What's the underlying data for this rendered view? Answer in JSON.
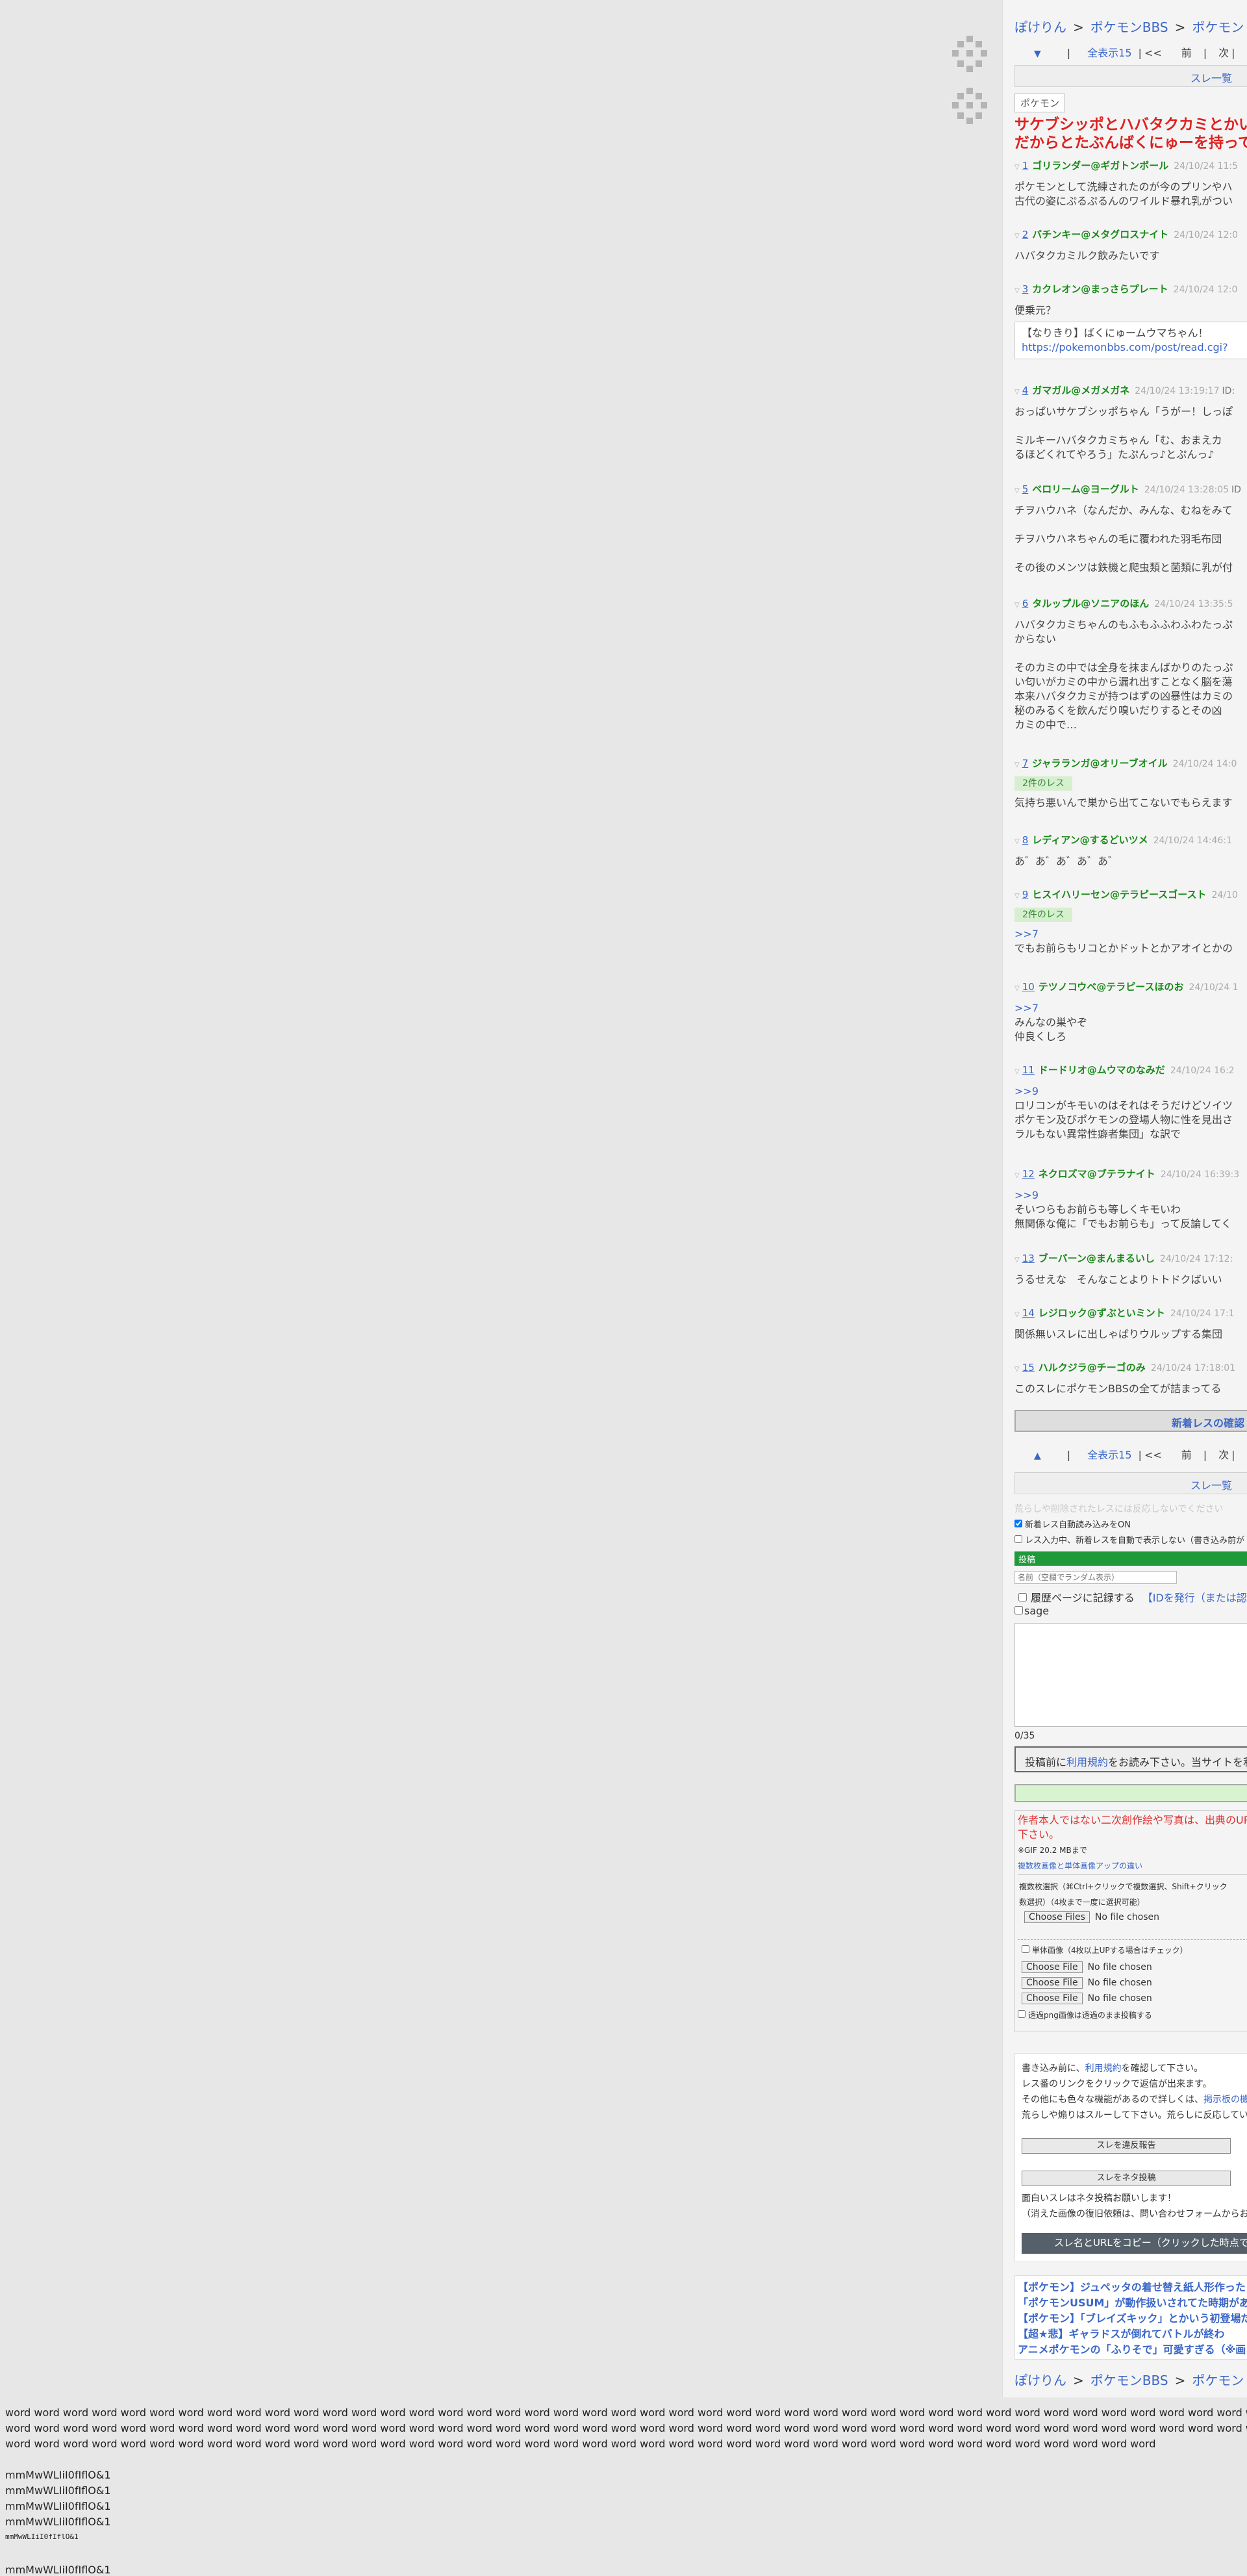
{
  "breadcrumb": [
    "ぽけりん",
    "ポケモンBBS",
    "ポケモン"
  ],
  "nav": {
    "down_arrow": "▼",
    "up_arrow": "▲",
    "show_all": "全表示15",
    "first": "<<",
    "prev": "前",
    "next": "次",
    "sep": "|"
  },
  "thread_list": "スレ一覧",
  "category_tag": "ポケモン",
  "title_lines": [
    "サケブシッポとハバタクカミとかい",
    "だからとたぶんばくにゅーを持って"
  ],
  "posts": [
    {
      "no": "1",
      "name": "ゴリランダー@ギガトンボール",
      "date": "24/10/24 11:5",
      "lines": [
        "ポケモンとして洗練されたのが今のプリンやハ",
        "古代の姿にぷるぷるんのワイルド暴れ乳がつい"
      ]
    },
    {
      "no": "2",
      "name": "バチンキー@メタグロスナイト",
      "date": "24/10/24 12:0",
      "lines": [
        "ハバタクカミルク飲みたいです"
      ]
    },
    {
      "no": "3",
      "name": "カクレオン@まっさらプレート",
      "date": "24/10/24 12:0",
      "lines": [
        "便乗元？"
      ],
      "quote": [
        "【なりきり】ばくにゅームウマちゃん！",
        "https://pokemonbbs.com/post/read.cgi?"
      ]
    },
    {
      "no": "4",
      "name": "ガマガル@メガメガネ",
      "date": "24/10/24 13:19:17",
      "id": "ID:",
      "lines": [
        "おっぱいサケブシッポちゃん「うがー！しっぽ",
        "",
        "ミルキーハバタクカミちゃん「む、おまえカ",
        "るほどくれてやろう」たぷんっ♪とぷんっ♪"
      ]
    },
    {
      "no": "5",
      "name": "ベロリーム@ヨーグルト",
      "date": "24/10/24 13:28:05",
      "id": "ID",
      "lines": [
        "チヲハウハネ（なんだか、みんな、むねをみて",
        "",
        "チヲハウハネちゃんの毛に覆われた羽毛布団",
        "",
        "その後のメンツは鉄機と爬虫類と菌類に乳が付"
      ]
    },
    {
      "no": "6",
      "name": "タルップル@ソニアのほん",
      "date": "24/10/24 13:35:5",
      "lines": [
        "ハバタクカミちゃんのもふもふふわふわたっぷ",
        "からない",
        "",
        "そのカミの中では全身を抹まんばかりのたっぷ",
        "い匂いがカミの中から漏れ出すことなく脳を蕩",
        "本来ハバタクカミが持つはずの凶暴性はカミの",
        "秘のみるくを飲んだり嗅いだりするとその凶",
        "カミの中で…"
      ]
    },
    {
      "no": "7",
      "name": "ジャラランガ@オリーブオイル",
      "date": "24/10/24 14:0",
      "badge": "2件のレス",
      "lines": [
        "気持ち悪いんで巣から出てこないでもらえます"
      ]
    },
    {
      "no": "8",
      "name": "レディアン@するどいツメ",
      "date": "24/10/24 14:46:1",
      "lines": [
        "あ゛あ゛あ゛あ゛あ゛"
      ]
    },
    {
      "no": "9",
      "name": "ヒスイハリーセン@テラピースゴースト",
      "date": "24/10",
      "badge": "2件のレス",
      "anchor": ">>7",
      "lines": [
        "でもお前らもリコとかドットとかアオイとかの"
      ]
    },
    {
      "no": "10",
      "name": "テツノコウベ@テラピースほのお",
      "date": "24/10/24 1",
      "anchor": ">>7",
      "lines": [
        "みんなの巣やぞ",
        "仲良くしろ"
      ]
    },
    {
      "no": "11",
      "name": "ドードリオ@ムウマのなみだ",
      "date": "24/10/24 16:2",
      "anchor": ">>9",
      "lines": [
        "ロリコンがキモいのはそれはそうだけどソイツ",
        "ポケモン及びポケモンの登場人物に性を見出さ",
        "ラルもない異常性癖者集団」な訳で"
      ]
    },
    {
      "no": "12",
      "name": "ネクロズマ@ブテラナイト",
      "date": "24/10/24 16:39:3",
      "anchor": ">>9",
      "lines": [
        "そいつらもお前らも等しくキモいわ",
        "無関係な俺に「でもお前らも」って反論してく"
      ]
    },
    {
      "no": "13",
      "name": "ブーバーン@まんまるいし",
      "date": "24/10/24 17:12:",
      "lines": [
        "うるせえな　そんなことよりトトドクばいい"
      ]
    },
    {
      "no": "14",
      "name": "レジロック@ずぶといミント",
      "date": "24/10/24 17:1",
      "lines": [
        "関係無いスレに出しゃばりウルップする集団"
      ]
    },
    {
      "no": "15",
      "name": "ハルクジラ@チーゴのみ",
      "date": "24/10/24 17:18:01",
      "lines": [
        "このスレにポケモンBBSの全てが詰まってる"
      ]
    }
  ],
  "new_res_check": "新着レスの確認",
  "notice_faint": "荒らしや削除されたレスには反応しないでください",
  "checks": [
    "新着レス自動読み込みをON",
    "レス入力中、新着レスを自動で表示しない（書き込み前が"
  ],
  "post_form": {
    "header": "投稿",
    "name_placeholder": "名前（空欄でランダム表示）",
    "history_label": "履歴ページに記録する",
    "id_link": "【IDを発行（または認証",
    "sage": "sage",
    "counter": "0/35",
    "terms_prefix": "投稿前に",
    "terms_link": "利用規約",
    "terms_suffix": "をお読み下さい。当サイトを利",
    "warn_lines": [
      "作者本人ではない二次創作絵や写真は、出典のURL",
      "下さい。"
    ],
    "gif_limit": "※GIF 20.2 MBまで",
    "multi_diff": "複数枚画像と単体画像アップの違い",
    "multi_help": [
      "複数枚選択（⌘Ctrl+クリックで複数選択、Shift+クリック",
      "数選択）（4枚まで一度に選択可能）"
    ],
    "choose_files": "Choose Files",
    "choose_file": "Choose File",
    "no_file": "No file chosen",
    "single_check": "単体画像（4枚以上UPする場合はチェック）",
    "png_check": "透過png画像は透過のまま投稿する"
  },
  "info": {
    "line1_prefix": "書き込み前に、",
    "line1_link": "利用規約",
    "line1_suffix": "を確認して下さい。",
    "line2": "レス番のリンクをクリックで返信が出来ます。",
    "line3_prefix": "その他にも色々な機能があるので詳しくは、",
    "line3_link": "掲示板の機能",
    "line3_suffix": "を",
    "line4": "荒らしや煽りはスルーして下さい。荒らしに反応している人",
    "report_button": "スレを違反報告",
    "neta_button": "スレをネタ投稿",
    "neta_note1": "面白いスレはネタ投稿お願いします！",
    "neta_note2": "（消えた画像の復旧依頼は、問い合わせフォームからお願い",
    "copy_button": "スレ名とURLをコピー（クリックした時点で"
  },
  "related": [
    "【ポケモン】ジュペッタの着せ替え紙人形作った",
    "「ポケモンUSUM」が動作扱いされてた時期があ",
    "【ポケモン】「ブレイズキック」とかいう初登場だ",
    "【超★悲】ギャラドスが倒れてバトルが終わ",
    "アニメポケモンの「ふりそで」可愛すぎる（※画"
  ],
  "filler_word": "word",
  "mm_lines": [
    "mmMwWLIiI0fIflO&1",
    "mmMwWLIiI0fIflO&1",
    "mmMwWLIiI0fIflO&1",
    "mmMwWLIiI0fIflO&1",
    "mmMwWLIiI0fIflO&1",
    "mmMwWLIiI0fIflO&1"
  ]
}
